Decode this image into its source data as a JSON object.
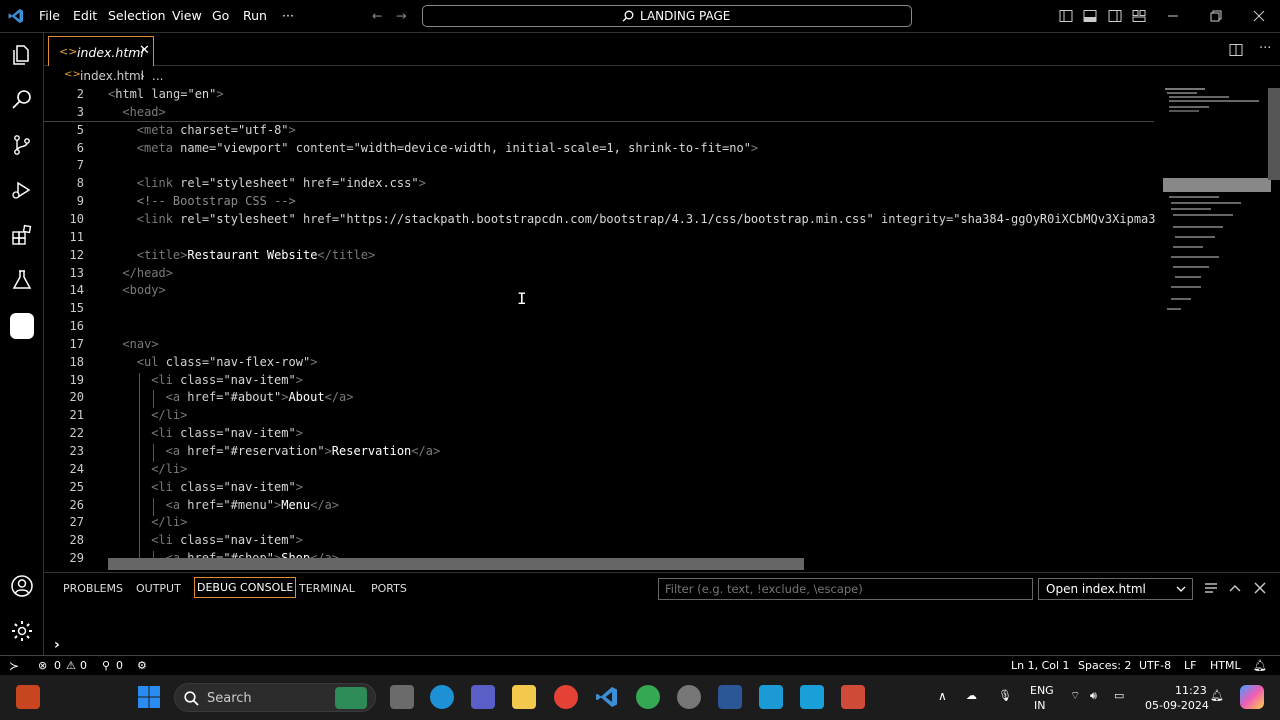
{
  "menu": {
    "file": "File",
    "edit": "Edit",
    "selection": "Selection",
    "view": "View",
    "go": "Go",
    "run": "Run",
    "more": "···"
  },
  "command_center": {
    "label": "LANDING PAGE"
  },
  "tab": {
    "label": "index.html",
    "icon": "<>",
    "close": "✕"
  },
  "breadcrumb": {
    "icon": "<>",
    "file": "index.html",
    "sep": "›",
    "rest": "..."
  },
  "code_lines": [
    {
      "n": "2",
      "indent": 0,
      "parts": [
        [
          "tag",
          "<"
        ],
        [
          "attr",
          "html lang="
        ],
        [
          "str",
          "\"en\""
        ],
        [
          "tag",
          ">"
        ]
      ]
    },
    {
      "n": "3",
      "indent": 1,
      "parts": [
        [
          "tag",
          "<head>"
        ]
      ]
    },
    {
      "n": "5",
      "indent": 2,
      "parts": [
        [
          "tag",
          "<meta "
        ],
        [
          "attr",
          "charset="
        ],
        [
          "str",
          "\"utf-8\""
        ],
        [
          "tag",
          ">"
        ]
      ]
    },
    {
      "n": "6",
      "indent": 2,
      "parts": [
        [
          "tag",
          "<meta "
        ],
        [
          "attr",
          "name="
        ],
        [
          "str",
          "\"viewport\" "
        ],
        [
          "attr",
          "content="
        ],
        [
          "str",
          "\"width=device-width, initial-scale=1, shrink-to-fit=no\""
        ],
        [
          "tag",
          ">"
        ]
      ]
    },
    {
      "n": "7",
      "indent": 0,
      "parts": []
    },
    {
      "n": "8",
      "indent": 2,
      "parts": [
        [
          "tag",
          "<link "
        ],
        [
          "attr",
          "rel="
        ],
        [
          "str",
          "\"stylesheet\" "
        ],
        [
          "attr",
          "href="
        ],
        [
          "str",
          "\"index.css\""
        ],
        [
          "tag",
          ">"
        ]
      ]
    },
    {
      "n": "9",
      "indent": 2,
      "parts": [
        [
          "cmt",
          "<!-- Bootstrap CSS -->"
        ]
      ]
    },
    {
      "n": "10",
      "indent": 2,
      "parts": [
        [
          "tag",
          "<link "
        ],
        [
          "attr",
          "rel="
        ],
        [
          "str",
          "\"stylesheet\" "
        ],
        [
          "attr",
          "href="
        ],
        [
          "str",
          "\"https://stackpath.bootstrapcdn.com/bootstrap/4.3.1/css/bootstrap.min.css\" "
        ],
        [
          "attr",
          "integrity="
        ],
        [
          "str",
          "\"sha384-ggOyR0iXCbMQv3Xipma3"
        ]
      ]
    },
    {
      "n": "11",
      "indent": 0,
      "parts": []
    },
    {
      "n": "12",
      "indent": 2,
      "parts": [
        [
          "tag",
          "<title>"
        ],
        [
          "txt",
          "Restaurant Website"
        ],
        [
          "tag",
          "</title>"
        ]
      ]
    },
    {
      "n": "13",
      "indent": 1,
      "parts": [
        [
          "tag",
          "</head>"
        ]
      ]
    },
    {
      "n": "14",
      "indent": 1,
      "parts": [
        [
          "tag",
          "<body>"
        ]
      ]
    },
    {
      "n": "15",
      "indent": 0,
      "parts": []
    },
    {
      "n": "16",
      "indent": 0,
      "parts": []
    },
    {
      "n": "17",
      "indent": 1,
      "parts": [
        [
          "tag",
          "<nav>"
        ]
      ]
    },
    {
      "n": "18",
      "indent": 2,
      "parts": [
        [
          "tag",
          "<ul "
        ],
        [
          "attr",
          "class="
        ],
        [
          "str",
          "\"nav-flex-row\""
        ],
        [
          "tag",
          ">"
        ]
      ]
    },
    {
      "n": "19",
      "indent": 3,
      "parts": [
        [
          "tag",
          "<li "
        ],
        [
          "attr",
          "class="
        ],
        [
          "str",
          "\"nav-item\""
        ],
        [
          "tag",
          ">"
        ]
      ]
    },
    {
      "n": "20",
      "indent": 4,
      "parts": [
        [
          "tag",
          "<a "
        ],
        [
          "attr",
          "href="
        ],
        [
          "str",
          "\"#about\""
        ],
        [
          "tag",
          ">"
        ],
        [
          "txt",
          "About"
        ],
        [
          "tag",
          "</a>"
        ]
      ]
    },
    {
      "n": "21",
      "indent": 3,
      "parts": [
        [
          "tag",
          "</li>"
        ]
      ]
    },
    {
      "n": "22",
      "indent": 3,
      "parts": [
        [
          "tag",
          "<li "
        ],
        [
          "attr",
          "class="
        ],
        [
          "str",
          "\"nav-item\""
        ],
        [
          "tag",
          ">"
        ]
      ]
    },
    {
      "n": "23",
      "indent": 4,
      "parts": [
        [
          "tag",
          "<a "
        ],
        [
          "attr",
          "href="
        ],
        [
          "str",
          "\"#reservation\""
        ],
        [
          "tag",
          ">"
        ],
        [
          "txt",
          "Reservation"
        ],
        [
          "tag",
          "</a>"
        ]
      ]
    },
    {
      "n": "24",
      "indent": 3,
      "parts": [
        [
          "tag",
          "</li>"
        ]
      ]
    },
    {
      "n": "25",
      "indent": 3,
      "parts": [
        [
          "tag",
          "<li "
        ],
        [
          "attr",
          "class="
        ],
        [
          "str",
          "\"nav-item\""
        ],
        [
          "tag",
          ">"
        ]
      ]
    },
    {
      "n": "26",
      "indent": 4,
      "parts": [
        [
          "tag",
          "<a "
        ],
        [
          "attr",
          "href="
        ],
        [
          "str",
          "\"#menu\""
        ],
        [
          "tag",
          ">"
        ],
        [
          "txt",
          "Menu"
        ],
        [
          "tag",
          "</a>"
        ]
      ]
    },
    {
      "n": "27",
      "indent": 3,
      "parts": [
        [
          "tag",
          "</li>"
        ]
      ]
    },
    {
      "n": "28",
      "indent": 3,
      "parts": [
        [
          "tag",
          "<li "
        ],
        [
          "attr",
          "class="
        ],
        [
          "str",
          "\"nav-item\""
        ],
        [
          "tag",
          ">"
        ]
      ]
    },
    {
      "n": "29",
      "indent": 4,
      "parts": [
        [
          "tag",
          "<a "
        ],
        [
          "attr",
          "href="
        ],
        [
          "str",
          "\"#shop\""
        ],
        [
          "tag",
          ">"
        ],
        [
          "txt",
          "Shop"
        ],
        [
          "tag",
          "</a>"
        ]
      ]
    }
  ],
  "panel": {
    "problems": "PROBLEMS",
    "output": "OUTPUT",
    "debug_console": "DEBUG CONSOLE",
    "terminal": "TERMINAL",
    "ports": "PORTS",
    "filter_placeholder": "Filter (e.g. text, !exclude, \\escape)",
    "open_select": "Open index.html",
    "prompt": "›"
  },
  "status": {
    "errors": "0",
    "warnings": "0",
    "ports": "0",
    "position": "Ln 1, Col 1",
    "spaces": "Spaces: 2",
    "encoding": "UTF-8",
    "eol": "LF",
    "language": "HTML"
  },
  "taskbar": {
    "search_label": "Search",
    "lang_top": "ENG",
    "lang_bottom": "IN",
    "time": "11:23",
    "date": "05-09-2024"
  },
  "colors": {
    "accent": "#e28e35",
    "background": "#000000",
    "taskbar": "#1c1c1c"
  }
}
